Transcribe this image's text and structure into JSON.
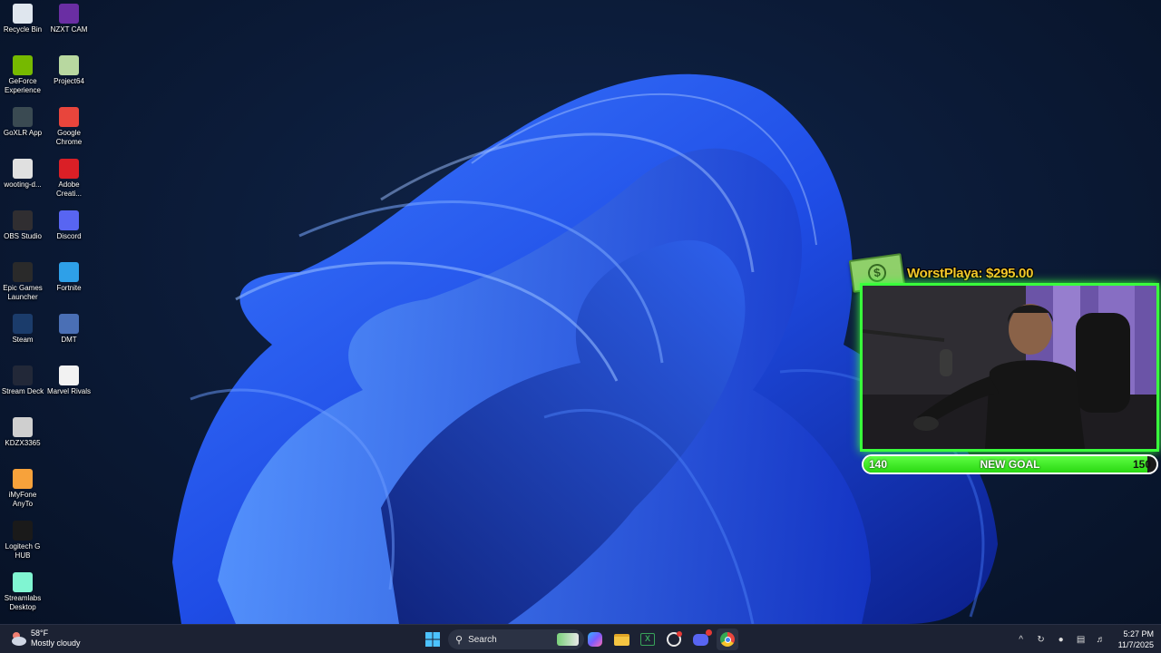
{
  "desktop": {
    "icons": [
      {
        "label": "Recycle Bin",
        "icon": "recycle-bin-icon",
        "color": "#dfe6ee"
      },
      {
        "label": "NZXT CAM",
        "icon": "nzxt-cam-icon",
        "color": "#6a2ea3"
      },
      {
        "label": "GeForce\nExperience",
        "icon": "geforce-icon",
        "color": "#76b900"
      },
      {
        "label": "Project64",
        "icon": "project64-icon",
        "color": "#b8d8a0"
      },
      {
        "label": "GoXLR App",
        "icon": "goxlr-icon",
        "color": "#3a4a52"
      },
      {
        "label": "Google\nChrome",
        "icon": "chrome-icon",
        "color": "#e8453c"
      },
      {
        "label": "wooting-d...",
        "icon": "wooting-icon",
        "color": "#e0e0e0"
      },
      {
        "label": "Adobe\nCreati...",
        "icon": "adobe-cc-icon",
        "color": "#da1f26"
      },
      {
        "label": "OBS Studio",
        "icon": "obs-icon",
        "color": "#302e31"
      },
      {
        "label": "Discord",
        "icon": "discord-icon",
        "color": "#5865f2"
      },
      {
        "label": "Epic Games\nLauncher",
        "icon": "epic-games-icon",
        "color": "#2a2a2a"
      },
      {
        "label": "Fortnite",
        "icon": "fortnite-icon",
        "color": "#2ea0e8"
      },
      {
        "label": "Steam",
        "icon": "steam-icon",
        "color": "#1b3c6b"
      },
      {
        "label": "DMT",
        "icon": "dmt-icon",
        "color": "#4a6fb5"
      },
      {
        "label": "Stream Deck",
        "icon": "stream-deck-icon",
        "color": "#222838"
      },
      {
        "label": "Marvel Rivals",
        "icon": "marvel-rivals-icon",
        "color": "#f2f2f2"
      },
      {
        "label": "KDZX3365",
        "icon": "kdzx-icon",
        "color": "#cfcfcf"
      },
      {
        "label": "iMyFone\nAnyTo",
        "icon": "imyfone-icon",
        "color": "#f7a23b"
      },
      {
        "label": "Logitech G\nHUB",
        "icon": "logitech-ghub-icon",
        "color": "#1a1a1a"
      },
      {
        "label": "Streamlabs\nDesktop",
        "icon": "streamlabs-icon",
        "color": "#80f5d2"
      }
    ]
  },
  "overlay": {
    "donation": "WorstPlaya: $295.00",
    "goal_start": "140",
    "goal_label": "NEW GOAL",
    "goal_end": "150",
    "goal_progress": 0.97,
    "accent": "#39ff3c",
    "donation_color": "#f7c62a"
  },
  "taskbar": {
    "weather_temp": "58°F",
    "weather_desc": "Mostly cloudy",
    "search_label": "Search",
    "apps": [
      "start-icon",
      "search-icon",
      "copilot-icon",
      "file-explorer-icon",
      "excel-icon",
      "obs-icon",
      "discord-icon",
      "chrome-icon"
    ],
    "clock_time": "5:27 PM",
    "clock_date": "11/7/2025"
  }
}
